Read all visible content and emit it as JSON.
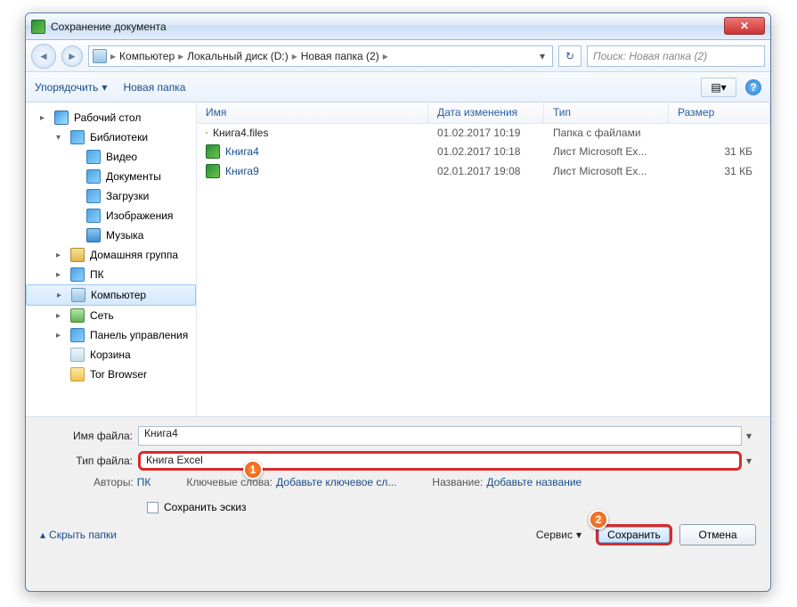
{
  "title": "Сохранение документа",
  "close": "✕",
  "nav": {
    "back": "◄",
    "fwd": "►"
  },
  "crumbs": [
    "Компьютер",
    "Локальный диск (D:)",
    "Новая папка (2)"
  ],
  "crumb_sep": "▸",
  "addr_drop": "▾",
  "refresh": "↻",
  "search_placeholder": "Поиск: Новая папка (2)",
  "toolbar": {
    "organize": "Упорядочить",
    "newfolder": "Новая папка",
    "view_glyph": "▤▾",
    "help": "?"
  },
  "tree": [
    {
      "label": "Рабочий стол",
      "ind": 0,
      "exp": "▸",
      "ico": "ico-desk"
    },
    {
      "label": "Библиотеки",
      "ind": 1,
      "exp": "▾",
      "ico": "ico-lib"
    },
    {
      "label": "Видео",
      "ind": 2,
      "exp": "",
      "ico": "ico-lib"
    },
    {
      "label": "Документы",
      "ind": 2,
      "exp": "",
      "ico": "ico-lib"
    },
    {
      "label": "Загрузки",
      "ind": 2,
      "exp": "",
      "ico": "ico-lib"
    },
    {
      "label": "Изображения",
      "ind": 2,
      "exp": "",
      "ico": "ico-lib"
    },
    {
      "label": "Музыка",
      "ind": 2,
      "exp": "",
      "ico": "ico-music"
    },
    {
      "label": "Домашняя группа",
      "ind": 1,
      "exp": "▸",
      "ico": "ico-hg"
    },
    {
      "label": "ПК",
      "ind": 1,
      "exp": "▸",
      "ico": "ico-lib"
    },
    {
      "label": "Компьютер",
      "ind": 1,
      "exp": "▸",
      "ico": "ico-comp",
      "sel": true
    },
    {
      "label": "Сеть",
      "ind": 1,
      "exp": "▸",
      "ico": "ico-net"
    },
    {
      "label": "Панель управления",
      "ind": 1,
      "exp": "▸",
      "ico": "ico-lib"
    },
    {
      "label": "Корзина",
      "ind": 1,
      "exp": "",
      "ico": "ico-trash"
    },
    {
      "label": "Tor Browser",
      "ind": 1,
      "exp": "",
      "ico": "ico-folder"
    }
  ],
  "cols": {
    "name": "Имя",
    "date": "Дата изменения",
    "type": "Тип",
    "size": "Размер"
  },
  "files": [
    {
      "name": "Книга4.files",
      "date": "01.02.2017 10:19",
      "type": "Папка с файлами",
      "size": "",
      "ico": "ico-folder",
      "plain": true
    },
    {
      "name": "Книга4",
      "date": "01.02.2017 10:18",
      "type": "Лист Microsoft Ex...",
      "size": "31 КБ",
      "ico": "ico-xl"
    },
    {
      "name": "Книга9",
      "date": "02.01.2017 19:08",
      "type": "Лист Microsoft Ex...",
      "size": "31 КБ",
      "ico": "ico-xl"
    }
  ],
  "fields": {
    "filename_lbl": "Имя файла:",
    "filename_val": "Книга4",
    "filetype_lbl": "Тип файла:",
    "filetype_val": "Книга Excel"
  },
  "meta": {
    "authors_lbl": "Авторы:",
    "authors_val": "ПК",
    "tags_lbl": "Ключевые слова:",
    "tags_val": "Добавьте ключевое сл...",
    "title_lbl": "Название:",
    "title_val": "Добавьте название"
  },
  "thumb": "Сохранить эскиз",
  "hide": "Скрыть папки",
  "service": "Сервис",
  "save": "Сохранить",
  "cancel": "Отмена",
  "ann": {
    "one": "1",
    "two": "2"
  }
}
